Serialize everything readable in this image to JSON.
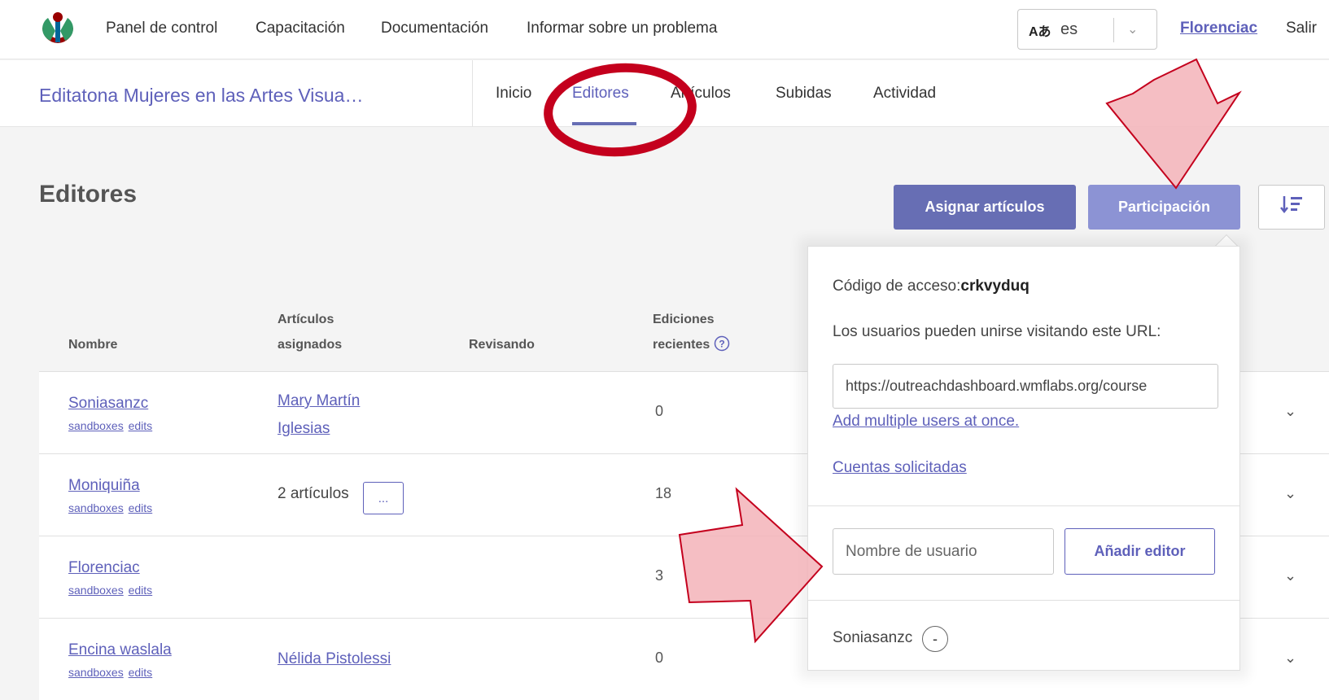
{
  "topnav": {
    "links": [
      "Panel de control",
      "Capacitación",
      "Documentación",
      "Informar sobre un problema"
    ],
    "language_icon": "Aあ",
    "language_value": "es",
    "username": "Florenciac",
    "logout": "Salir"
  },
  "course": {
    "title": "Editatona Mujeres en las Artes Visua…",
    "tabs": [
      "Inicio",
      "Editores",
      "Artículos",
      "Subidas",
      "Actividad"
    ],
    "active_tab": "Editores"
  },
  "section": {
    "title": "Editores",
    "assign_button": "Asignar artículos",
    "participation_button": "Participación",
    "sort_icon": "sort-icon"
  },
  "table": {
    "headers": {
      "name": "Nombre",
      "assigned_line1": "Artículos",
      "assigned_line2": "asignados",
      "reviewing": "Revisando",
      "recent_line1": "Ediciones",
      "recent_line2": "recientes"
    },
    "sandboxes_label": "sandboxes",
    "edits_label": "edits",
    "rows": [
      {
        "name": "Soniasanzc",
        "assigned_line1": "Mary Martín",
        "assigned_line2": "Iglesias",
        "recent": "0"
      },
      {
        "name": "Moniquiña",
        "assigned_text": "2 artículos",
        "more_label": "...",
        "recent": "18"
      },
      {
        "name": "Florenciac",
        "recent": "3"
      },
      {
        "name": "Encina waslala",
        "assigned_line1": "Nélida Pistolessi",
        "recent": "0"
      }
    ]
  },
  "popover": {
    "access_code_label": "Código de acceso:",
    "access_code": "crkvyduq",
    "join_description": "Los usuarios pueden unirse visitando este URL:",
    "join_url": "https://outreachdashboard.wmflabs.org/course",
    "add_multiple": "Add multiple users at once.",
    "requested_accounts": "Cuentas solicitadas",
    "username_placeholder": "Nombre de usuario",
    "add_editor_button": "Añadir editor",
    "enrolled_user": "Soniasanzc",
    "remove_label": "-"
  },
  "colors": {
    "accent": "#676eb4",
    "accent_light": "#8c93d4",
    "link": "#5e60ba",
    "annotation": "#c4001d"
  }
}
